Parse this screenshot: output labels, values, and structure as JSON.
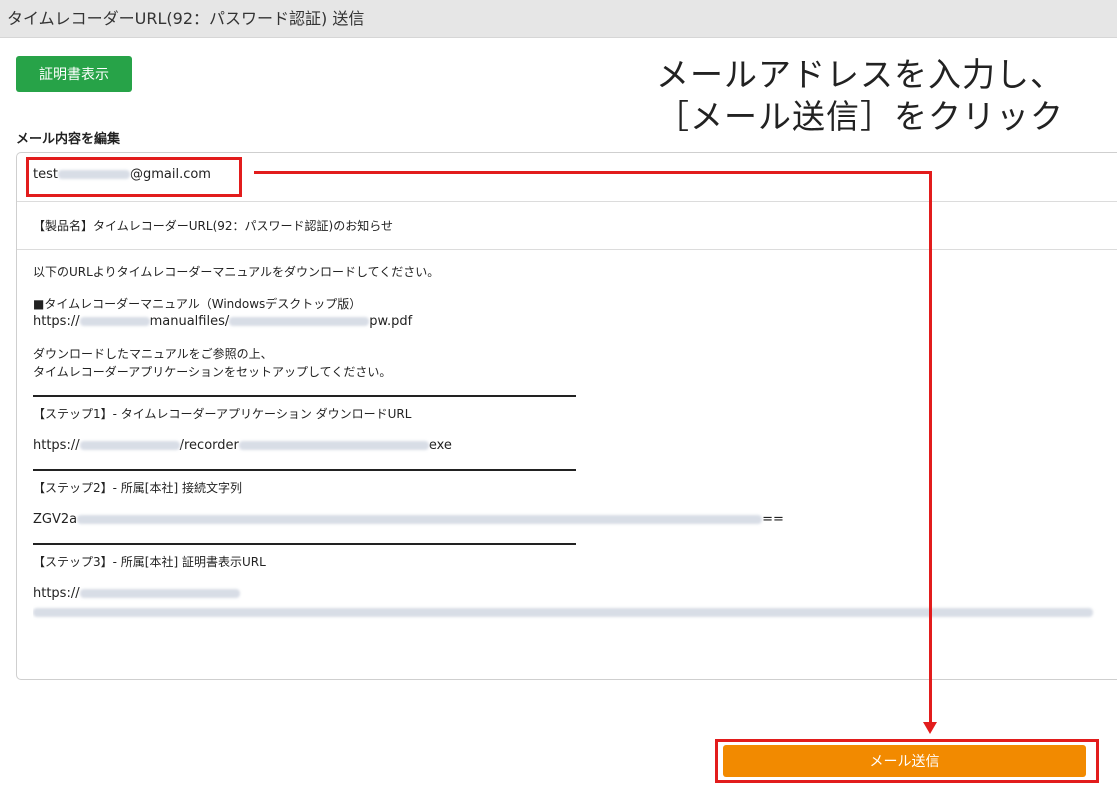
{
  "window": {
    "title": "タイムレコーダーURL(92：パスワード認証) 送信"
  },
  "buttons": {
    "certificate": "証明書表示",
    "send": "メール送信"
  },
  "annotation": {
    "line1": "メールアドレスを入力し、",
    "line2": "［メール送信］をクリック"
  },
  "section": {
    "label": "メール内容を編集"
  },
  "email": {
    "to_visible": "test",
    "to_domain": "@gmail.com",
    "subject": "【製品名】タイムレコーダーURL(92：パスワード認証)のお知らせ",
    "body": {
      "intro": "以下のURLよりタイムレコーダーマニュアルをダウンロードしてください。",
      "manual_heading": "■タイムレコーダーマニュアル（Windowsデスクトップ版）",
      "manual_url_prefix": "https://",
      "manual_url_mid": "manualfiles/",
      "manual_url_suffix": "pw.pdf",
      "ref_line1": "ダウンロードしたマニュアルをご参照の上、",
      "ref_line2": "タイムレコーダーアプリケーションをセットアップしてください。",
      "step1_title": "【ステップ1】- タイムレコーダーアプリケーション ダウンロードURL",
      "step1_url_prefix": "https://",
      "step1_url_mid": "/recorder",
      "step1_url_suffix": "exe",
      "step2_title": "【ステップ2】- 所属[本社] 接続文字列",
      "step2_value_prefix": "ZGV2a",
      "step2_value_suffix": "==",
      "step3_title": "【ステップ3】- 所属[本社] 証明書表示URL",
      "step3_url_prefix": "https://"
    }
  },
  "colors": {
    "accent_red": "#e21c1c",
    "send_orange": "#f28a00",
    "cert_green": "#27a348"
  }
}
